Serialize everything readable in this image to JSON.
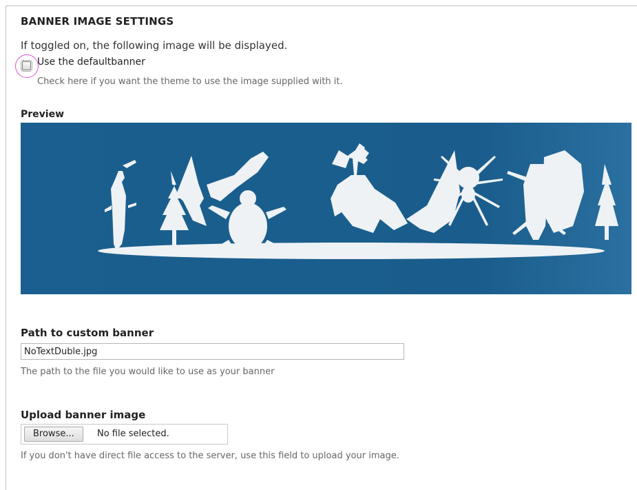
{
  "banner_settings": {
    "title": "BANNER IMAGE SETTINGS",
    "intro": "If toggled on, the following image will be displayed.",
    "default_checkbox": {
      "label": "Use the defaultbanner",
      "checked": false,
      "description": "Check here if you want the theme to use the image supplied with it."
    }
  },
  "preview": {
    "title": "Preview",
    "background_color": "#1a5d8c",
    "silhouette_color": "#eef2f5",
    "icon": "insect-and-plant-silhouettes-banner"
  },
  "custom_path": {
    "label": "Path to custom banner",
    "value": "NoTextDuble.jpg",
    "description": "The path to the file you would like to use as your banner"
  },
  "upload": {
    "label": "Upload banner image",
    "browse_label": "Browse...",
    "status": "No file selected.",
    "description": "If you don't have direct file access to the server, use this field to upload your image."
  },
  "colors": {
    "highlight_ring": "#e04fd4"
  }
}
